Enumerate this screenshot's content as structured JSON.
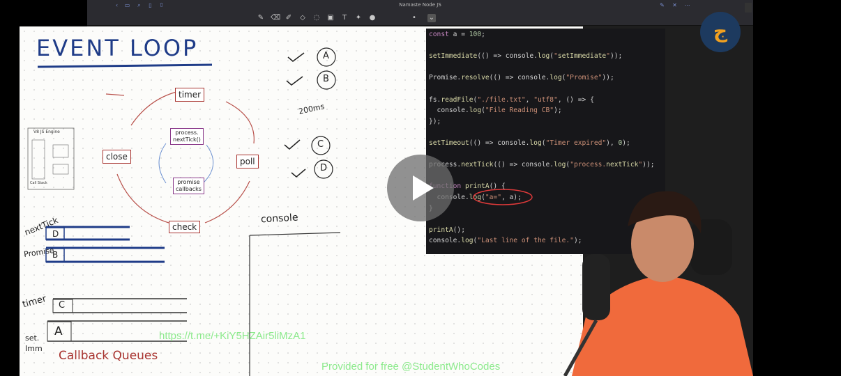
{
  "window": {
    "title": "Namaste Node JS"
  },
  "whiteboard": {
    "heading": "EVENT LOOP",
    "phases": {
      "timer": "timer",
      "poll": "poll",
      "check": "check",
      "close": "close"
    },
    "inner": {
      "next_tick": "process.\nnextTick()",
      "promise": "promise\ncallbacks"
    },
    "engine_box": {
      "title": "V8 JS Engine",
      "call_stack": "Call Stack"
    },
    "microtask_labels": {
      "next_tick": "nextTick",
      "promise": "Promise"
    },
    "queue_items": {
      "d": "D",
      "b": "B",
      "c": "C",
      "a": "A"
    },
    "macrotask_labels": {
      "timer": "timer",
      "set_immediate": "set.\nImm"
    },
    "callback_queues": "Callback Queues",
    "console_label": "console",
    "markers": [
      "A",
      "B",
      "C",
      "D"
    ],
    "fs_time": "200ms"
  },
  "code_lines": [
    "const a = 100;",
    "",
    "setImmediate(() => console.log(\"setImmediate\"));",
    "",
    "Promise.resolve(() => console.log(\"Promise\"));",
    "",
    "fs.readFile(\"./file.txt\", \"utf8\", () => {",
    "  console.log(\"File Reading CB\");",
    "});",
    "",
    "setTimeout(() => console.log(\"Timer expired\"), 0);",
    "",
    "process.nextTick(() => console.log(\"process.nextTick\"));",
    "",
    "function printA() {",
    "  console.log(\"a=\", a);",
    "}",
    "",
    "printA();",
    "console.log(\"Last line of the file.\");"
  ],
  "watermarks": {
    "link": "https://t.me/+KiY5HZAir5liMzA1",
    "credit": "Provided for free @StudentWhoCodes"
  },
  "colors": {
    "pen_blue": "#1f3c88",
    "pen_red": "#a8332f",
    "accent_green": "#5cd65c"
  }
}
